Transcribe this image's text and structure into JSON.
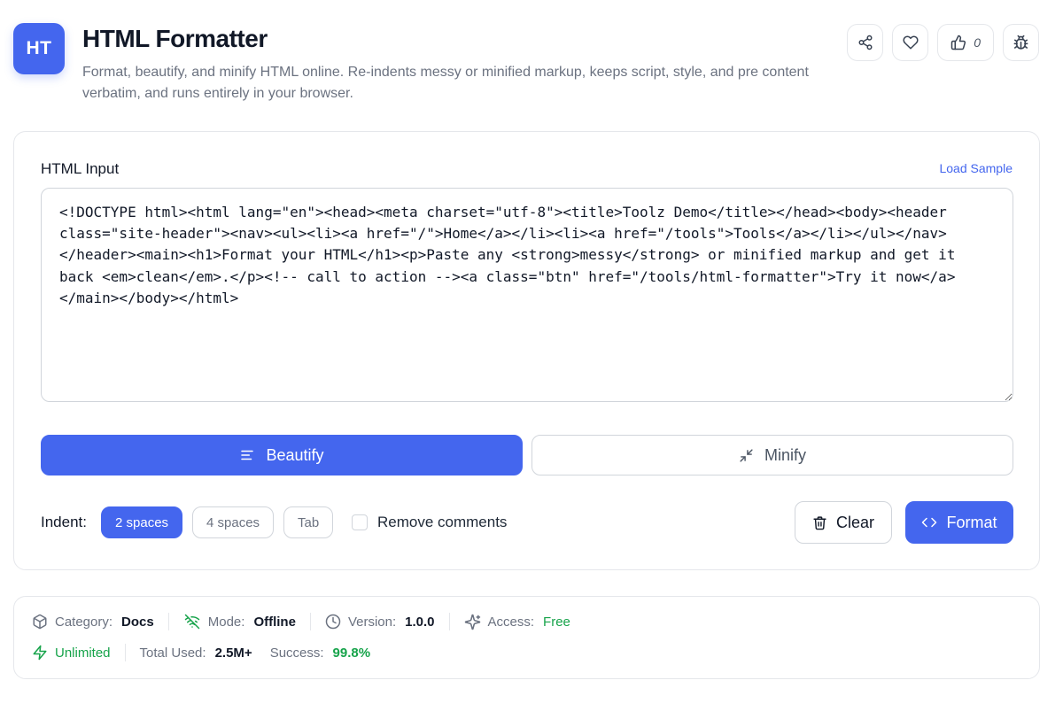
{
  "header": {
    "logo_text": "HT",
    "title": "HTML Formatter",
    "description": "Format, beautify, and minify HTML online. Re-indents messy or minified markup, keeps script, style, and pre content verbatim, and runs entirely in your browser.",
    "like_count": "0",
    "actions": [
      "share-icon",
      "heart-icon",
      "thumbs-up-icon",
      "bug-icon"
    ]
  },
  "editor": {
    "label": "HTML Input",
    "load_sample": "Load Sample",
    "value": "<!DOCTYPE html><html lang=\"en\"><head><meta charset=\"utf-8\"><title>Toolz Demo</title></head><body><header class=\"site-header\"><nav><ul><li><a href=\"/\">Home</a></li><li><a href=\"/tools\">Tools</a></li></ul></nav></header><main><h1>Format your HTML</h1><p>Paste any <strong>messy</strong> or minified markup and get it back <em>clean</em>.</p><!-- call to action --><a class=\"btn\" href=\"/tools/html-formatter\">Try it now</a></main></body></html>"
  },
  "modes": {
    "beautify": "Beautify",
    "minify": "Minify",
    "selected": "Beautify"
  },
  "options": {
    "indent_label": "Indent:",
    "indent_options": [
      "2 spaces",
      "4 spaces",
      "Tab"
    ],
    "indent_selected": "2 spaces",
    "remove_comments_label": "Remove comments",
    "remove_comments_checked": false,
    "clear_label": "Clear",
    "format_label": "Format"
  },
  "stats": {
    "category_label": "Category:",
    "category_value": "Docs",
    "mode_label": "Mode:",
    "mode_value": "Offline",
    "version_label": "Version:",
    "version_value": "1.0.0",
    "access_label": "Access:",
    "access_value": "Free",
    "unlimited": "Unlimited",
    "total_used_label": "Total Used:",
    "total_used_value": "2.5M+",
    "success_label": "Success:",
    "success_value": "99.8%"
  },
  "colors": {
    "accent": "#4466ee",
    "success": "#16a34a",
    "border": "#e5e7eb",
    "muted_text": "#6b7280"
  }
}
